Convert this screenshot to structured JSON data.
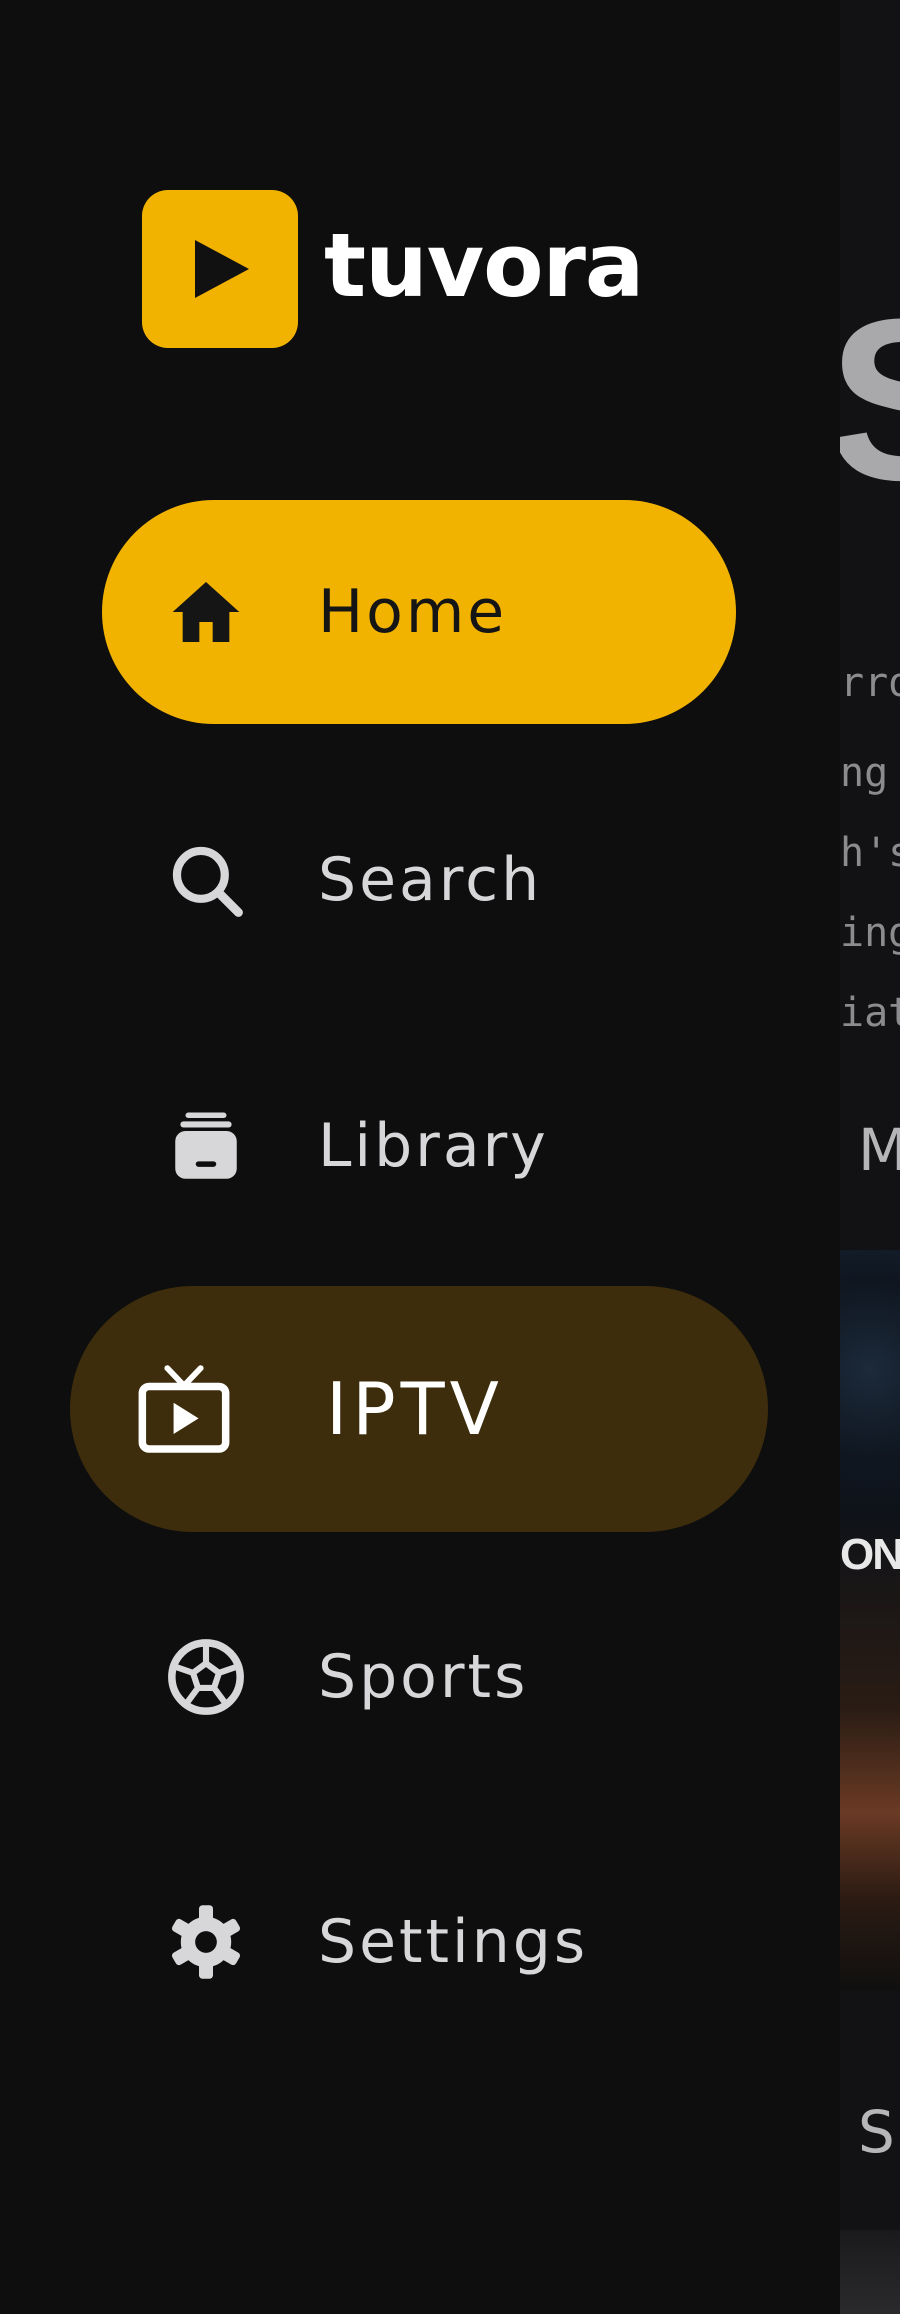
{
  "app": {
    "brand_name": "tuvora",
    "accent_color": "#f2b300",
    "focus_color": "#3d2d0c",
    "logo_icon": "play-icon"
  },
  "nav": {
    "items": [
      {
        "id": "home",
        "label": "Home",
        "icon": "home-icon",
        "state": "selected"
      },
      {
        "id": "search",
        "label": "Search",
        "icon": "search-icon",
        "state": "default"
      },
      {
        "id": "library",
        "label": "Library",
        "icon": "library-icon",
        "state": "default"
      },
      {
        "id": "iptv",
        "label": "IPTV",
        "icon": "tv-icon",
        "state": "focused"
      },
      {
        "id": "sports",
        "label": "Sports",
        "icon": "soccer-ball-icon",
        "state": "default"
      },
      {
        "id": "settings",
        "label": "Settings",
        "icon": "gear-icon",
        "state": "default"
      }
    ]
  },
  "background": {
    "hero_title_fragment": "SI",
    "description_fragments": [
      "rro",
      "ng",
      "h's",
      "ing",
      "iat"
    ],
    "section_1_fragment": "M",
    "card_badge_fragment": "ON",
    "section_2_fragment": "S"
  }
}
